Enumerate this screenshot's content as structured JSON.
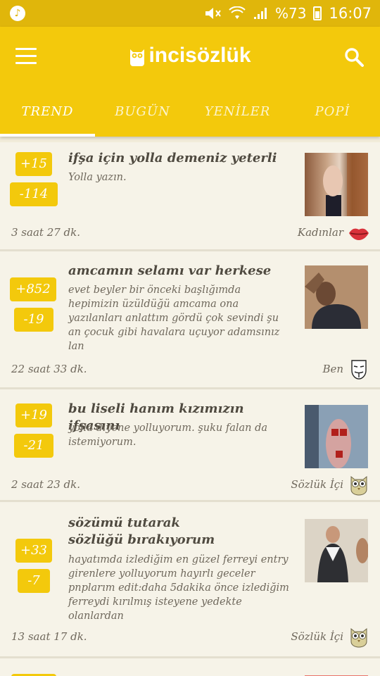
{
  "status_bar": {
    "battery": "%73",
    "time": "16:07",
    "music_icon": "music-note-icon",
    "icons": [
      "mute-icon",
      "wifi-icon",
      "signal-icon",
      "battery-icon"
    ]
  },
  "app_bar": {
    "logo_text": "incisözlük",
    "menu_icon": "hamburger-menu-icon",
    "search_icon": "search-icon"
  },
  "tabs": [
    {
      "label": "TREND",
      "active": true
    },
    {
      "label": "BUGÜN",
      "active": false
    },
    {
      "label": "YENİLER",
      "active": false
    },
    {
      "label": "POPİ",
      "active": false
    }
  ],
  "entries": [
    {
      "upvotes": "+15",
      "downvotes": "-114",
      "title": "ifşa için yolla demeniz yeterli",
      "body": "Yolla yazın.",
      "time": "3 saat 27 dk.",
      "category": "Kadınlar",
      "category_icon": "lips-icon"
    },
    {
      "upvotes": "+852",
      "downvotes": "-19",
      "title": "amcamın selamı var herkese",
      "body": "evet beyler bir önceki başlığımda hepimizin üzüldüğü amcama ona yazılanları anlattım gördü çok sevindi şu an çocuk gibi havalara uçuyor adamsınız lan",
      "time": "22 saat 33 dk.",
      "category": "Ben",
      "category_icon": "mask-icon"
    },
    {
      "upvotes": "+19",
      "downvotes": "-21",
      "title": "bu liseli hanım kızımızın ifşasını",
      "body": "yolla diyene yolluyorum. şuku falan da istemiyorum.",
      "time": "2 saat 23 dk.",
      "category": "Sözlük İçi",
      "category_icon": "owl-icon"
    },
    {
      "upvotes": "+33",
      "downvotes": "-7",
      "title": "sözümü tutarak sözlüğü bırakıyorum",
      "body": "hayatımda izlediğim en güzel ferreyi entry girenlere yolluyorum hayırlı geceler pnplarım edit:daha 5dakika önce izlediğim ferreydi kırılmış isteyene yedekte olanlardan",
      "time": "13 saat 17 dk.",
      "category": "Sözlük İçi",
      "category_icon": "owl-icon"
    }
  ],
  "colors": {
    "brand_yellow": "#f3c90c",
    "status_yellow": "#e0b60b",
    "background": "#f1ecd9"
  }
}
